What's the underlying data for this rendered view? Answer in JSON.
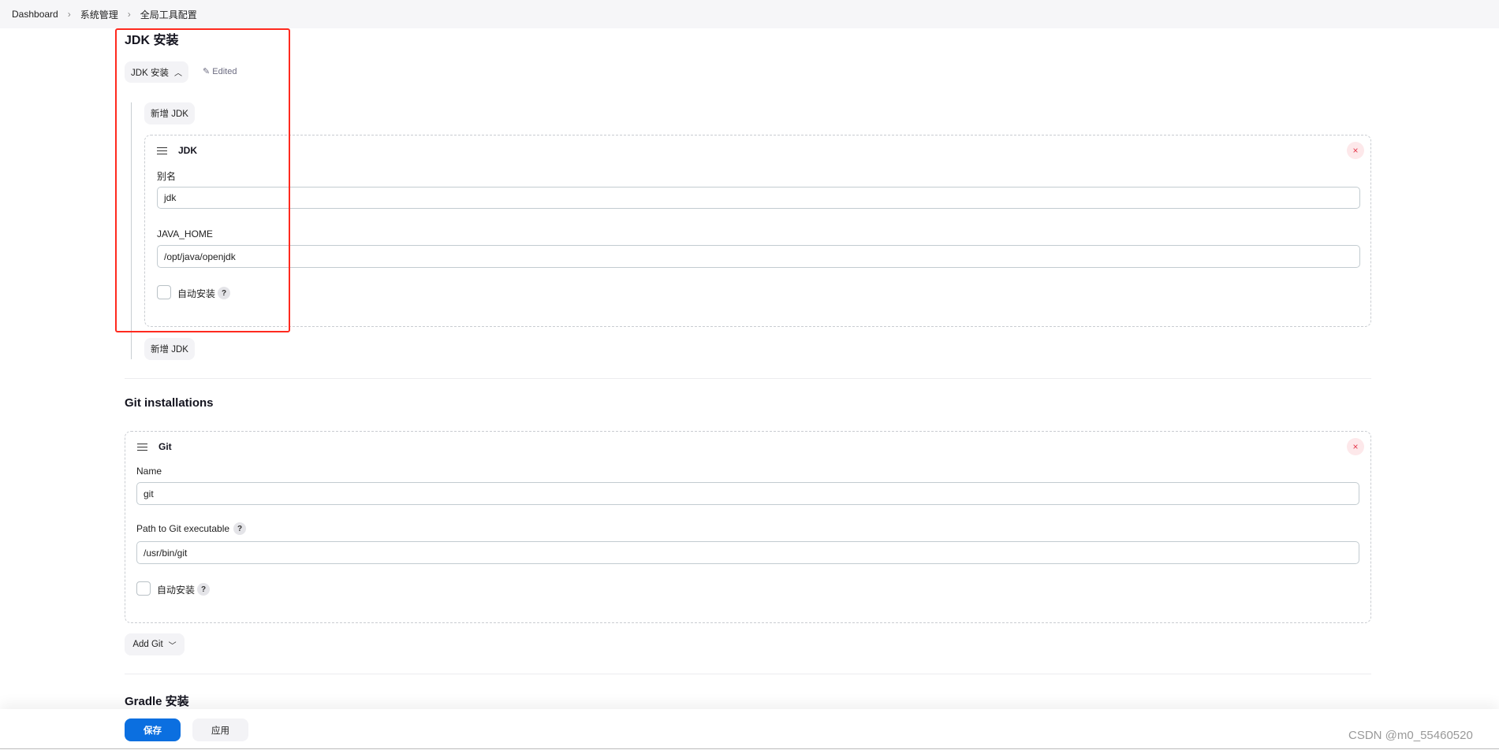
{
  "breadcrumb": [
    "Dashboard",
    "系统管理",
    "全局工具配置"
  ],
  "jdk": {
    "title": "JDK 安装",
    "dropdown_label": "JDK 安装",
    "edited": "Edited",
    "add_label": "新增 JDK",
    "card_title": "JDK",
    "alias_label": "别名",
    "alias_value": "jdk",
    "home_label": "JAVA_HOME",
    "home_value": "/opt/java/openjdk",
    "auto_install": "自动安装",
    "auto_checked": false
  },
  "git": {
    "title": "Git installations",
    "card_title": "Git",
    "name_label": "Name",
    "name_value": "git",
    "path_label": "Path to Git executable",
    "path_value": "/usr/bin/git",
    "auto_install": "自动安装",
    "auto_checked": false,
    "add_label": "Add Git"
  },
  "gradle": {
    "title": "Gradle 安装"
  },
  "footer": {
    "save": "保存",
    "apply": "应用"
  },
  "watermark": "CSDN @m0_55460520",
  "colors": {
    "primary": "#0b6fe0",
    "highlight": "#ff2a1f"
  },
  "help": "?",
  "close": "×"
}
